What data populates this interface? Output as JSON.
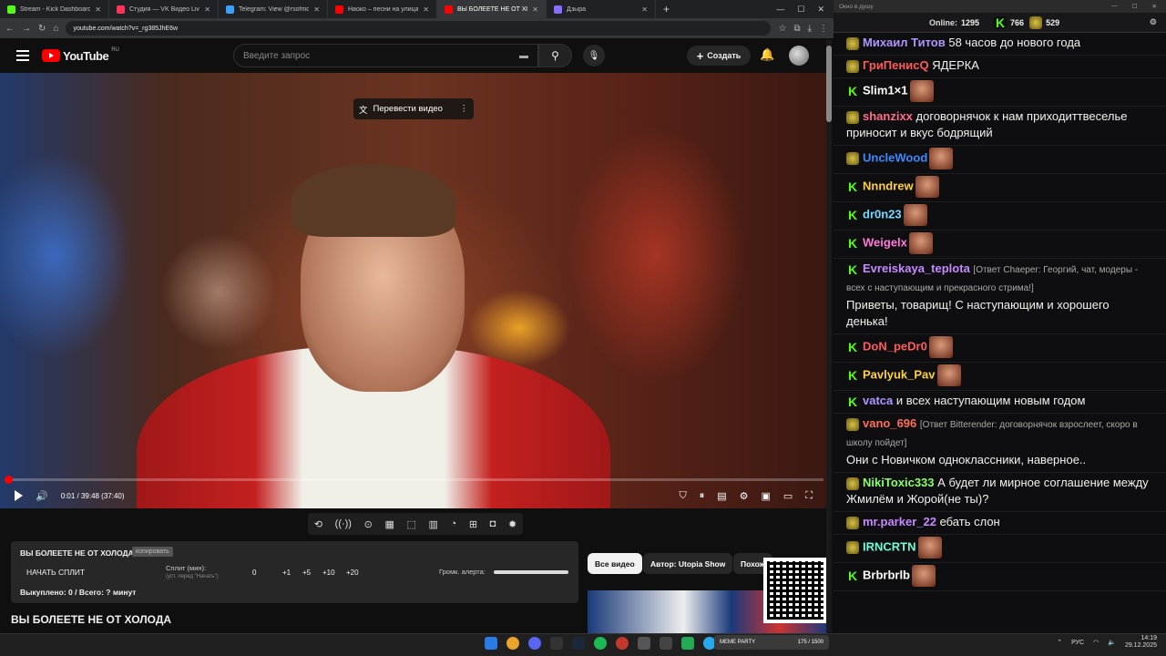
{
  "browser": {
    "tabs": [
      {
        "title": "Stream - Kick Dashboard",
        "color": "#53fc18",
        "active": false
      },
      {
        "title": "Студия — VK Видео Live",
        "color": "#ff3355",
        "active": false
      },
      {
        "title": "Telegram: View @rsofmdivision",
        "color": "#3aa0ff",
        "active": false
      },
      {
        "title": "Наоко – песни на улицах, арт-...",
        "color": "#ff0000",
        "active": false
      },
      {
        "title": "ВЫ БОЛЕЕТЕ НЕ ОТ ХОЛОДА",
        "color": "#ff0000",
        "active": true
      },
      {
        "title": "Дзыра",
        "color": "#8a6cff",
        "active": false
      }
    ],
    "new_tab": "+",
    "window_controls": [
      "—",
      "☐",
      "✕"
    ],
    "url": "youtube.com/watch?v=_rg385JhE6w"
  },
  "youtube": {
    "logo_text": "YouTube",
    "logo_region": "RU",
    "search_placeholder": "Введите запрос",
    "create_label": "Создать",
    "translate_label": "Перевести видео",
    "time_display": "0:01 / 39:48 (37:40)",
    "progress_fraction": 0.0004,
    "video_title": "ВЫ БОЛЕЕТЕ НЕ ОТ ХОЛОДА",
    "chips": [
      "Все видео",
      "Автор: Utopia Show",
      "Похож"
    ]
  },
  "split_panel": {
    "title": "ВЫ БОЛЕЕТЕ НЕ ОТ ХОЛОДА",
    "copy_label": "копировать",
    "start_label": "НАЧАТЬ СПЛИТ",
    "split_label": "Сплит (мин):",
    "split_hint": "(уст. перед \"Начать\")",
    "value": "0",
    "steps": [
      "+1",
      "+5",
      "+10",
      "+20"
    ],
    "alert_label": "Громк. алерта:",
    "bought": "Выкуплено: 0 / Всего: ? минут"
  },
  "chat": {
    "window_title": "Окно в душу",
    "online_label": "Online:",
    "online_count": "1295",
    "kick_count": "766",
    "coin_count": "529",
    "messages": [
      {
        "nick": "Михаил Титов",
        "color": "#b094ff",
        "badge": "y",
        "text": "58 часов до нового года"
      },
      {
        "nick": "ГриПенисQ",
        "color": "#ff5a5a",
        "badge": "y",
        "text": "ЯДЕРКА"
      },
      {
        "nick": "Slim1×1",
        "color": "#ffffff",
        "badge": "k",
        "text": ""
      },
      {
        "nick": "shanzixx",
        "color": "#ff6e8a",
        "badge": "y",
        "text": "договорнячок к нам приходиттвеселье приносит и вкус бодрящий"
      },
      {
        "nick": "UncleWood",
        "color": "#3a8aff",
        "badge": "y",
        "text": ""
      },
      {
        "nick": "Nnndrew",
        "color": "#ffd23a",
        "badge": "k",
        "text": ""
      },
      {
        "nick": "dr0n23",
        "color": "#7ad8ff",
        "badge": "k",
        "text": ""
      },
      {
        "nick": "Weigelx",
        "color": "#ff7ad8",
        "badge": "k",
        "text": ""
      },
      {
        "nick": "Evreiskaya_teplota",
        "color": "#c68aff",
        "badge": "k",
        "reply": "[Ответ Chaeper: Георгий, чат, модеры - всех с наступающим и прекрасного стрима!]",
        "text": "Приветы, товарищ! С наступающим и хорошего денька!"
      },
      {
        "nick": "DoN_peDr0",
        "color": "#ff5a5a",
        "badge": "k",
        "text": ""
      },
      {
        "nick": "Pavlyuk_Pav",
        "color": "#ffd23a",
        "badge": "k",
        "text": ""
      },
      {
        "nick": "vatca",
        "color": "#b094ff",
        "badge": "k",
        "text": "и всех наступающим новым годом"
      },
      {
        "nick": "vano_696",
        "color": "#ff6e5a",
        "badge": "y",
        "reply": "[Ответ Bitterender: договорнячок взрослеет, скоро в школу пойдет]",
        "text": "Они с Новичком одноклассники, наверное.."
      },
      {
        "nick": "NikiToxic333",
        "color": "#8aff6a",
        "badge": "y",
        "text": "А будет ли мирное соглашение между Жмилём и Жорой(не ты)?"
      },
      {
        "nick": "mr.parker_22",
        "color": "#c68aff",
        "badge": "y",
        "text": "ебать слон"
      },
      {
        "nick": "IRNCRTN",
        "color": "#6affd8",
        "badge": "y",
        "text": ""
      },
      {
        "nick": "Brbrbrlb",
        "color": "#ffffff",
        "badge": "k",
        "text": ""
      }
    ]
  },
  "taskbar": {
    "meme_party": "МЕМЕ PARTY",
    "meme_count": "175 / 1500",
    "lang": "РУС",
    "time": "14:19",
    "date": "29.12.2025"
  }
}
